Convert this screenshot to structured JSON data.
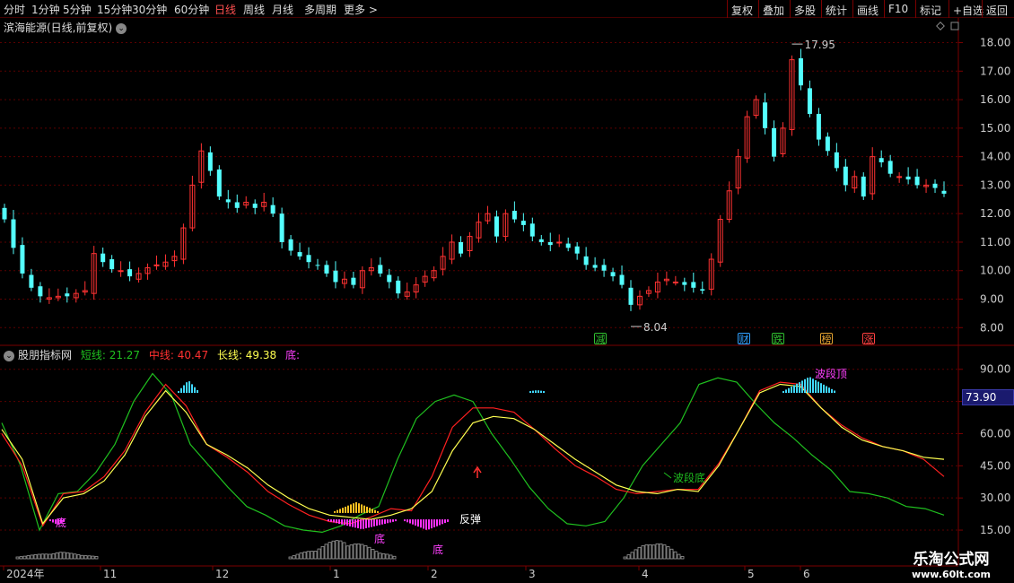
{
  "toolbar": {
    "periods": [
      "分时",
      "1分钟",
      "5分钟",
      "15分钟",
      "30分钟",
      "60分钟",
      "日线",
      "周线",
      "月线",
      "多周期",
      "更多 >"
    ],
    "active_period": "日线",
    "right_buttons": [
      "复权",
      "叠加",
      "多股",
      "统计",
      "画线",
      "F10",
      "标记",
      "+自选",
      "返回"
    ]
  },
  "stock": {
    "title": "滨海能源(日线,前复权)"
  },
  "main_chart": {
    "y_ticks": [
      "18.00",
      "17.00",
      "16.00",
      "15.00",
      "14.00",
      "13.00",
      "12.00",
      "11.00",
      "10.00",
      "9.00",
      "8.00"
    ],
    "high_label": "17.95",
    "low_label": "8.04",
    "event_tags": [
      {
        "text": "减",
        "color": "#30c030"
      },
      {
        "text": "财",
        "color": "#30a0ff"
      },
      {
        "text": "跌",
        "color": "#30c030"
      },
      {
        "text": "榜",
        "color": "#e0a030"
      },
      {
        "text": "涨",
        "color": "#ff4040"
      }
    ]
  },
  "indicator": {
    "name": "股朋指标网",
    "short_label": "短线: 21.27",
    "mid_label": "中线: 40.47",
    "long_label": "长线: 49.38",
    "bottom_label": "底:",
    "y_ticks": [
      "90.00",
      "75.00",
      "60.00",
      "45.00",
      "30.00",
      "15.00"
    ],
    "current_value": "73.90",
    "annotations": {
      "wave_top": "波段顶",
      "wave_bottom": "波段底",
      "rebound": "反弹",
      "bottom1": "底",
      "bottom2": "底",
      "bottom3": "底"
    }
  },
  "x_axis": {
    "labels": [
      "2024年",
      "11",
      "12",
      "1",
      "2",
      "3",
      "4",
      "5",
      "6"
    ]
  },
  "watermark": {
    "title": "乐淘公式网",
    "url": "www.60lt.com"
  },
  "colors": {
    "up": "#ff3232",
    "down": "#54ffff",
    "short": "#1fbf1f",
    "mid": "#ff2020",
    "long": "#ffff50",
    "grid": "#5a0000"
  },
  "chart_data": {
    "type": "candlestick",
    "closes": [
      11.8,
      10.8,
      9.9,
      9.4,
      9.1,
      9.05,
      9.1,
      9.1,
      9.2,
      9.3,
      10.6,
      10.3,
      10.05,
      10.0,
      9.8,
      9.9,
      10.1,
      10.2,
      10.3,
      10.5,
      11.5,
      13.0,
      14.2,
      13.5,
      12.6,
      12.4,
      12.2,
      12.4,
      12.2,
      12.4,
      12.0,
      11.0,
      10.7,
      10.5,
      10.3,
      10.2,
      9.9,
      9.6,
      9.7,
      9.5,
      10.0,
      10.1,
      9.9,
      9.6,
      9.2,
      9.25,
      9.5,
      9.8,
      10.0,
      10.5,
      11.0,
      10.6,
      11.2,
      11.7,
      12.0,
      11.2,
      12.0,
      11.8,
      11.6,
      11.2,
      11.0,
      10.9,
      11.0,
      10.8,
      10.6,
      10.2,
      10.1,
      10.0,
      9.8,
      9.5,
      8.8,
      9.1,
      9.3,
      9.6,
      9.7,
      9.6,
      9.5,
      9.4,
      9.3,
      10.4,
      11.8,
      12.8,
      14.0,
      15.4,
      16.0,
      15.0,
      14.0,
      15.0,
      17.4,
      16.5,
      15.5,
      14.6,
      14.2,
      13.6,
      13.0,
      13.3,
      12.6,
      14.0,
      13.8,
      13.4,
      13.3,
      13.2,
      13.0,
      13.0,
      12.9,
      12.7
    ],
    "series": [
      {
        "name": "短线",
        "values": [
          65,
          45,
          15,
          32,
          33,
          42,
          55,
          75,
          88,
          78,
          55,
          45,
          35,
          26,
          22,
          17,
          15,
          14,
          17,
          22,
          26,
          48,
          67,
          75,
          78,
          75,
          60,
          48,
          35,
          25,
          18,
          17,
          19,
          30,
          45,
          55,
          65,
          83,
          86,
          84,
          74,
          65,
          58,
          50,
          43,
          33,
          32,
          30,
          26,
          25,
          22
        ]
      },
      {
        "name": "中线",
        "values": [
          60,
          45,
          17,
          32,
          33,
          40,
          52,
          70,
          83,
          73,
          55,
          49,
          42,
          33,
          27,
          22,
          19,
          18,
          21,
          25,
          24,
          40,
          63,
          72,
          72,
          70,
          62,
          53,
          45,
          40,
          34,
          32,
          33,
          34,
          34,
          46,
          62,
          80,
          84,
          83,
          72,
          64,
          58,
          54,
          52,
          48,
          40
        ]
      },
      {
        "name": "长线",
        "values": [
          62,
          48,
          18,
          30,
          32,
          38,
          50,
          68,
          80,
          70,
          55,
          50,
          44,
          36,
          30,
          25,
          22,
          21,
          20,
          22,
          25,
          33,
          52,
          65,
          68,
          67,
          62,
          55,
          48,
          42,
          36,
          33,
          32,
          34,
          33,
          45,
          62,
          79,
          83,
          82,
          72,
          63,
          57,
          54,
          52,
          49,
          48
        ]
      }
    ],
    "x_labels": [
      "2024年",
      "11",
      "12",
      "1",
      "2",
      "3",
      "4",
      "5",
      "6"
    ],
    "ylim_main": [
      7.6,
      18.3
    ],
    "ylim_indicator": [
      10,
      97
    ]
  }
}
